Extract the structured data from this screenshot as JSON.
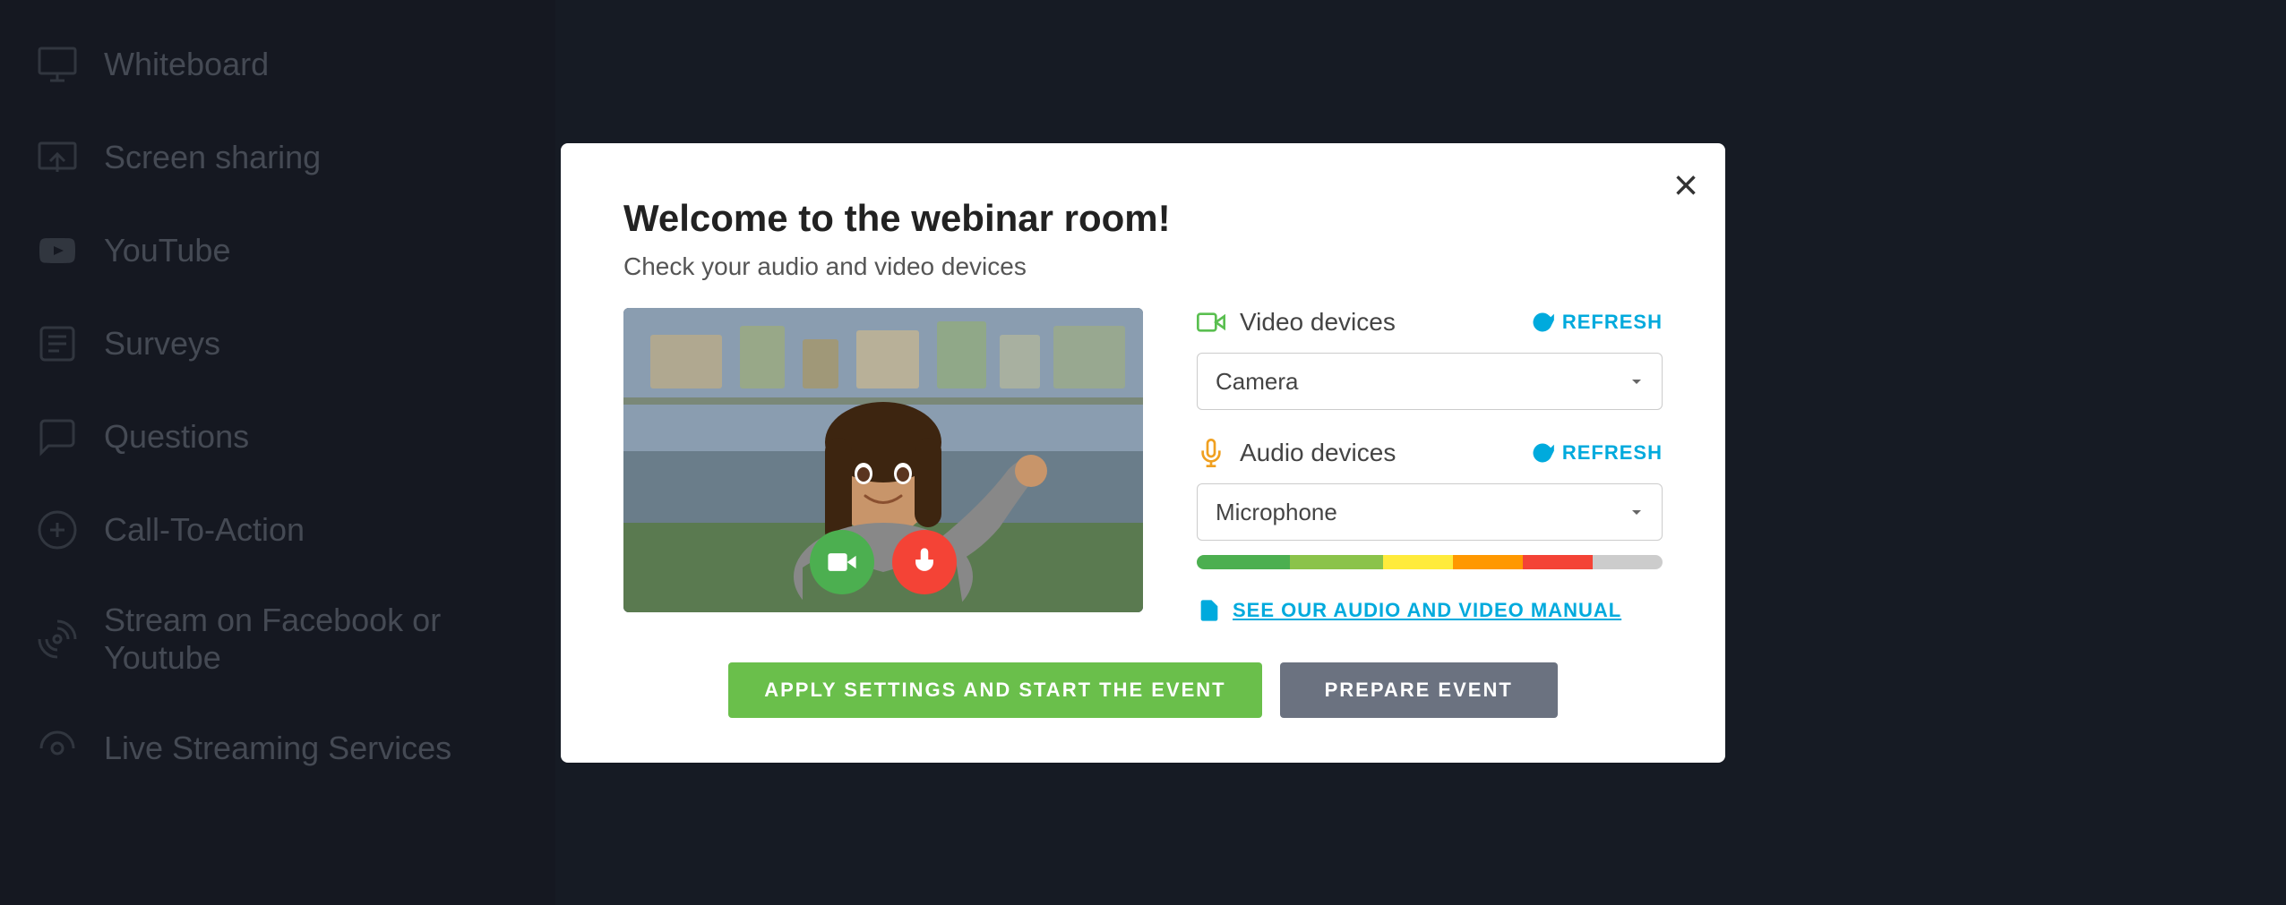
{
  "sidebar": {
    "items": [
      {
        "id": "whiteboard",
        "label": "Whiteboard",
        "icon": "whiteboard-icon"
      },
      {
        "id": "screen-sharing",
        "label": "Screen sharing",
        "icon": "screen-share-icon"
      },
      {
        "id": "youtube",
        "label": "YouTube",
        "icon": "youtube-icon"
      },
      {
        "id": "surveys",
        "label": "Surveys",
        "icon": "surveys-icon"
      },
      {
        "id": "questions",
        "label": "Questions",
        "icon": "questions-icon"
      },
      {
        "id": "call-to-action",
        "label": "Call-To-Action",
        "icon": "call-to-action-icon"
      },
      {
        "id": "stream-facebook",
        "label": "Stream on Facebook or Youtube",
        "icon": "stream-icon"
      },
      {
        "id": "live-streaming",
        "label": "Live Streaming Services",
        "icon": "live-streaming-icon"
      }
    ]
  },
  "modal": {
    "title": "Welcome to the webinar room!",
    "subtitle": "Check your audio and video devices",
    "close_label": "×",
    "video_section": {
      "label": "Video devices",
      "refresh_label": "REFRESH",
      "camera_option": "Camera"
    },
    "audio_section": {
      "label": "Audio devices",
      "refresh_label": "REFRESH",
      "microphone_option": "Microphone"
    },
    "manual_link": "SEE OUR AUDIO AND VIDEO MANUAL",
    "buttons": {
      "apply": "APPLY SETTINGS AND START THE EVENT",
      "prepare": "PREPARE EVENT"
    }
  }
}
